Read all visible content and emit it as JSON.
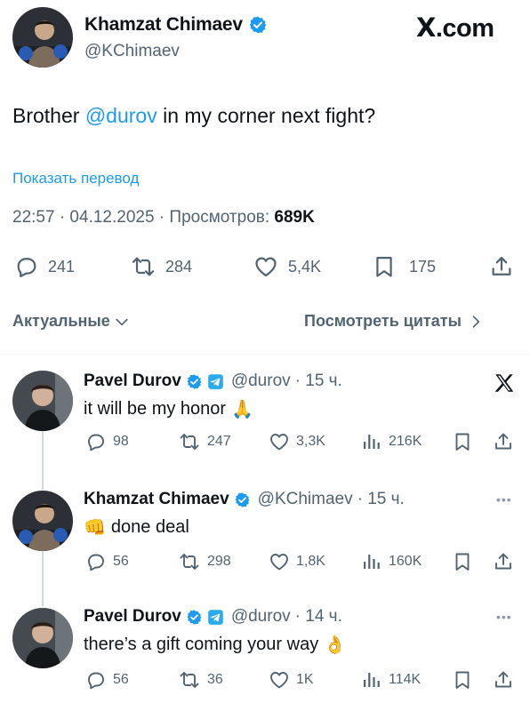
{
  "brand": {
    "logo_text": ".com",
    "logo_x": "X"
  },
  "main_tweet": {
    "author": {
      "name": "Khamzat Chimaev",
      "handle": "@KChimaev"
    },
    "text_before": "Brother ",
    "mention": "@durov",
    "text_after": " in my corner next fight?",
    "translate_link": "Показать перевод",
    "time": "22:57 · 04.12.2025 · ",
    "views_label": "Просмотров: ",
    "views_value": "689K",
    "actions": {
      "replies": "241",
      "reposts": "284",
      "likes": "5,4K",
      "bookmarks": "175"
    }
  },
  "sort": {
    "left_label": "Актуальные",
    "right_label": "Посмотреть цитаты"
  },
  "replies": [
    {
      "name": "Pavel Durov",
      "handle": "@durov",
      "time": "· 15 ч.",
      "text": "it will be my honor",
      "emoji": "🙏",
      "stats": {
        "replies": "98",
        "reposts": "247",
        "likes": "3,3K",
        "views": "216K"
      }
    },
    {
      "name": "Khamzat Chimaev",
      "handle": "@KChimaev",
      "time": "· 15 ч.",
      "text": "done deal",
      "emoji": "👊",
      "stats": {
        "replies": "56",
        "reposts": "298",
        "likes": "1,8K",
        "views": "160K"
      }
    },
    {
      "name": "Pavel Durov",
      "handle": "@durov",
      "time": "· 14 ч.",
      "text": "there’s a gift coming your way",
      "emoji": "👌",
      "stats": {
        "replies": "56",
        "reposts": "36",
        "likes": "1K",
        "views": "114K"
      }
    }
  ],
  "colors": {
    "accent": "#1d9bf0",
    "muted": "#536471",
    "verified": "#1d9bf0",
    "telegram": "#2aabee"
  }
}
